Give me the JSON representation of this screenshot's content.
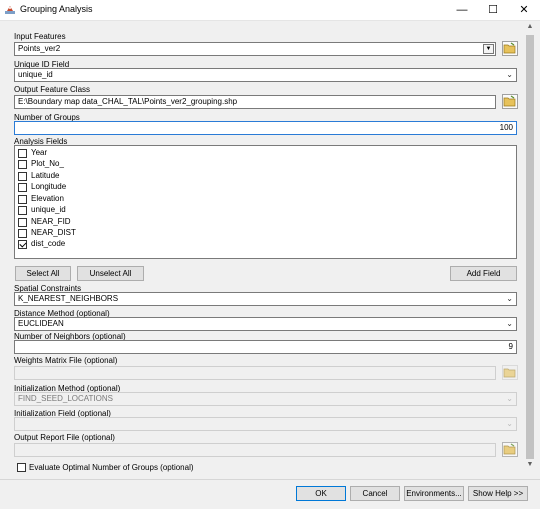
{
  "window": {
    "title": "Grouping Analysis",
    "minimize": "—",
    "maximize": "☐",
    "close": "✕"
  },
  "fields": {
    "input_features": {
      "label": "Input Features",
      "value": "Points_ver2"
    },
    "unique_id": {
      "label": "Unique ID Field",
      "value": "unique_id"
    },
    "output_class": {
      "label": "Output Feature Class",
      "value": "E:\\Boundary map data_CHAL_TAL\\Points_ver2_grouping.shp"
    },
    "num_groups": {
      "label": "Number of Groups",
      "value": "100"
    },
    "analysis_fields": {
      "label": "Analysis Fields",
      "items": [
        {
          "label": "Year",
          "checked": false
        },
        {
          "label": "Plot_No_",
          "checked": false
        },
        {
          "label": "Latitude",
          "checked": false
        },
        {
          "label": "Longitude",
          "checked": false
        },
        {
          "label": "Elevation",
          "checked": false
        },
        {
          "label": "unique_id",
          "checked": false
        },
        {
          "label": "NEAR_FID",
          "checked": false
        },
        {
          "label": "NEAR_DIST",
          "checked": false
        },
        {
          "label": "dist_code",
          "checked": true
        }
      ]
    },
    "spatial_constraints": {
      "label": "Spatial Constraints",
      "value": "K_NEAREST_NEIGHBORS"
    },
    "distance_method": {
      "label": "Distance Method (optional)",
      "value": "EUCLIDEAN"
    },
    "num_neighbors": {
      "label": "Number of Neighbors (optional)",
      "value": "9"
    },
    "weights_matrix": {
      "label": "Weights Matrix File (optional)",
      "value": ""
    },
    "init_method": {
      "label": "Initialization Method (optional)",
      "value": "FIND_SEED_LOCATIONS"
    },
    "init_field": {
      "label": "Initialization Field (optional)",
      "value": ""
    },
    "output_report": {
      "label": "Output Report File (optional)",
      "value": ""
    }
  },
  "list_buttons": {
    "select_all": "Select All",
    "unselect_all": "Unselect All",
    "add_field": "Add Field"
  },
  "evaluate": {
    "label": "Evaluate Optimal Number of Groups (optional)",
    "checked": false
  },
  "footer": {
    "ok": "OK",
    "cancel": "Cancel",
    "environments": "Environments...",
    "show_help": "Show Help >>"
  }
}
